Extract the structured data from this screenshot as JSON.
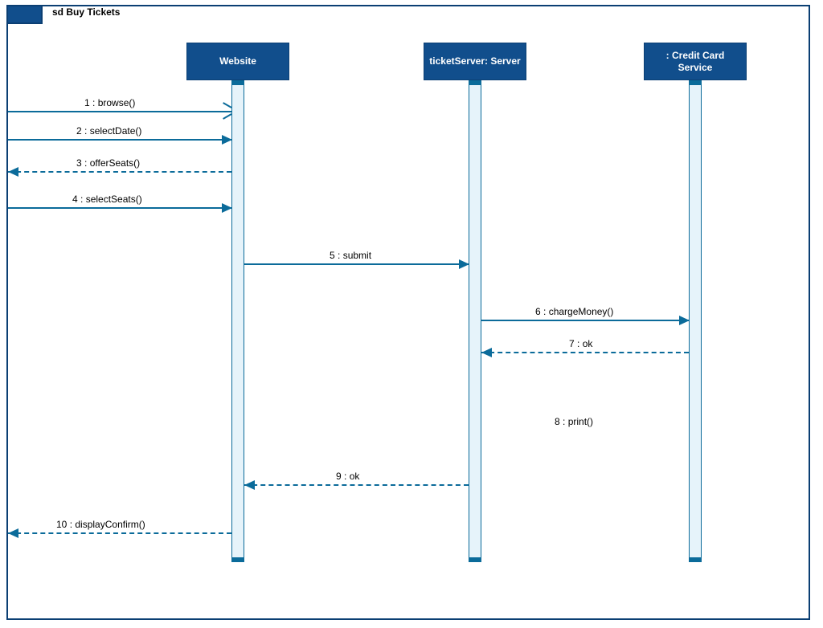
{
  "frame": {
    "label": "sd Buy Tickets"
  },
  "participants": {
    "website": "Website",
    "server": "ticketServer: Server",
    "credit": ": Credit Card Service"
  },
  "messages": {
    "m1": {
      "num": "1",
      "label": "browse()"
    },
    "m2": {
      "num": "2",
      "label": "selectDate()"
    },
    "m3": {
      "num": "3",
      "label": "offerSeats()"
    },
    "m4": {
      "num": "4",
      "label": "selectSeats()"
    },
    "m5": {
      "num": "5",
      "label": "submit"
    },
    "m6": {
      "num": "6",
      "label": "chargeMoney()"
    },
    "m7": {
      "num": "7",
      "label": "ok"
    },
    "m8": {
      "num": "8",
      "label": "print()"
    },
    "m9": {
      "num": "9",
      "label": "ok"
    },
    "m10": {
      "num": "10",
      "label": "displayConfirm()"
    }
  }
}
